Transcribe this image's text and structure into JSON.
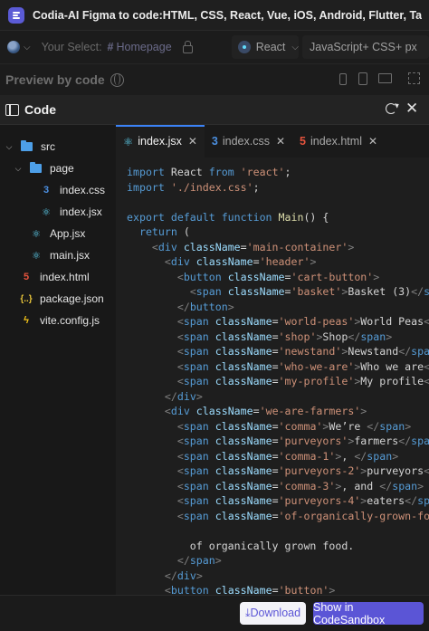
{
  "window": {
    "title": "Codia-AI Figma to code:HTML, CSS, React, Vue, iOS, Android, Flutter, Tailwind, W..."
  },
  "toolbar": {
    "your_select_label": "Your Select:",
    "hash": "#",
    "page_name": "Homepage",
    "framework": "React",
    "language": "JavaScript+ CSS+ px",
    "chevron": "⌵"
  },
  "preview": {
    "title": "Preview by code"
  },
  "code_panel": {
    "title": "Code",
    "close": "✕"
  },
  "file_tree": {
    "items": [
      {
        "label": "src",
        "chevron": "⌵"
      },
      {
        "label": "page",
        "chevron": "⌵"
      },
      {
        "label": "index.css",
        "icon": "3"
      },
      {
        "label": "index.jsx",
        "icon": "⚛"
      },
      {
        "label": "App.jsx",
        "icon": "⚛"
      },
      {
        "label": "main.jsx",
        "icon": "⚛"
      },
      {
        "label": "index.html",
        "icon": "5"
      },
      {
        "label": "package.json",
        "icon": "{..}"
      },
      {
        "label": "vite.config.js",
        "icon": "ϟ"
      }
    ]
  },
  "tabs": [
    {
      "label": "index.jsx",
      "icon": "⚛",
      "close": "✕"
    },
    {
      "label": "index.css",
      "icon": "3",
      "close": "✕"
    },
    {
      "label": "index.html",
      "icon": "5",
      "close": "✕"
    }
  ],
  "code": [
    [
      [
        "kw",
        "import "
      ],
      [
        "pl",
        "React "
      ],
      [
        "kw",
        "from "
      ],
      [
        "str",
        "'react'"
      ],
      [
        "pl",
        ";"
      ]
    ],
    [
      [
        "kw",
        "import "
      ],
      [
        "str",
        "'./index.css'"
      ],
      [
        "pl",
        ";"
      ]
    ],
    [],
    [
      [
        "kw",
        "export default function "
      ],
      [
        "fn",
        "Main"
      ],
      [
        "pl",
        "() {"
      ]
    ],
    [
      [
        "pl",
        "  "
      ],
      [
        "kw",
        "return"
      ],
      [
        "pl",
        " ("
      ]
    ],
    [
      [
        "pl",
        "    "
      ],
      [
        "br",
        "<"
      ],
      [
        "tg",
        "div "
      ],
      [
        "at",
        "className"
      ],
      [
        "pl",
        "="
      ],
      [
        "str",
        "'main-container'"
      ],
      [
        "br",
        ">"
      ]
    ],
    [
      [
        "pl",
        "      "
      ],
      [
        "br",
        "<"
      ],
      [
        "tg",
        "div "
      ],
      [
        "at",
        "className"
      ],
      [
        "pl",
        "="
      ],
      [
        "str",
        "'header'"
      ],
      [
        "br",
        ">"
      ]
    ],
    [
      [
        "pl",
        "        "
      ],
      [
        "br",
        "<"
      ],
      [
        "tg",
        "button "
      ],
      [
        "at",
        "className"
      ],
      [
        "pl",
        "="
      ],
      [
        "str",
        "'cart-button'"
      ],
      [
        "br",
        ">"
      ]
    ],
    [
      [
        "pl",
        "          "
      ],
      [
        "br",
        "<"
      ],
      [
        "tg",
        "span "
      ],
      [
        "at",
        "className"
      ],
      [
        "pl",
        "="
      ],
      [
        "str",
        "'basket'"
      ],
      [
        "br",
        ">"
      ],
      [
        "pl",
        "Basket (3)"
      ],
      [
        "br",
        "</"
      ],
      [
        "tg",
        "span"
      ],
      [
        "br",
        ">"
      ]
    ],
    [
      [
        "pl",
        "        "
      ],
      [
        "br",
        "</"
      ],
      [
        "tg",
        "button"
      ],
      [
        "br",
        ">"
      ]
    ],
    [
      [
        "pl",
        "        "
      ],
      [
        "br",
        "<"
      ],
      [
        "tg",
        "span "
      ],
      [
        "at",
        "className"
      ],
      [
        "pl",
        "="
      ],
      [
        "str",
        "'world-peas'"
      ],
      [
        "br",
        ">"
      ],
      [
        "pl",
        "World Peas"
      ],
      [
        "br",
        "</"
      ],
      [
        "tg",
        "span"
      ],
      [
        "br",
        ">"
      ]
    ],
    [
      [
        "pl",
        "        "
      ],
      [
        "br",
        "<"
      ],
      [
        "tg",
        "span "
      ],
      [
        "at",
        "className"
      ],
      [
        "pl",
        "="
      ],
      [
        "str",
        "'shop'"
      ],
      [
        "br",
        ">"
      ],
      [
        "pl",
        "Shop"
      ],
      [
        "br",
        "</"
      ],
      [
        "tg",
        "span"
      ],
      [
        "br",
        ">"
      ]
    ],
    [
      [
        "pl",
        "        "
      ],
      [
        "br",
        "<"
      ],
      [
        "tg",
        "span "
      ],
      [
        "at",
        "className"
      ],
      [
        "pl",
        "="
      ],
      [
        "str",
        "'newstand'"
      ],
      [
        "br",
        ">"
      ],
      [
        "pl",
        "Newstand"
      ],
      [
        "br",
        "</"
      ],
      [
        "tg",
        "span"
      ],
      [
        "br",
        ">"
      ]
    ],
    [
      [
        "pl",
        "        "
      ],
      [
        "br",
        "<"
      ],
      [
        "tg",
        "span "
      ],
      [
        "at",
        "className"
      ],
      [
        "pl",
        "="
      ],
      [
        "str",
        "'who-we-are'"
      ],
      [
        "br",
        ">"
      ],
      [
        "pl",
        "Who we are"
      ],
      [
        "br",
        "</"
      ],
      [
        "tg",
        "span"
      ],
      [
        "br",
        ">"
      ]
    ],
    [
      [
        "pl",
        "        "
      ],
      [
        "br",
        "<"
      ],
      [
        "tg",
        "span "
      ],
      [
        "at",
        "className"
      ],
      [
        "pl",
        "="
      ],
      [
        "str",
        "'my-profile'"
      ],
      [
        "br",
        ">"
      ],
      [
        "pl",
        "My profile"
      ],
      [
        "br",
        "</"
      ],
      [
        "tg",
        "span"
      ],
      [
        "br",
        ">"
      ]
    ],
    [
      [
        "pl",
        "      "
      ],
      [
        "br",
        "</"
      ],
      [
        "tg",
        "div"
      ],
      [
        "br",
        ">"
      ]
    ],
    [
      [
        "pl",
        "      "
      ],
      [
        "br",
        "<"
      ],
      [
        "tg",
        "div "
      ],
      [
        "at",
        "className"
      ],
      [
        "pl",
        "="
      ],
      [
        "str",
        "'we-are-farmers'"
      ],
      [
        "br",
        ">"
      ]
    ],
    [
      [
        "pl",
        "        "
      ],
      [
        "br",
        "<"
      ],
      [
        "tg",
        "span "
      ],
      [
        "at",
        "className"
      ],
      [
        "pl",
        "="
      ],
      [
        "str",
        "'comma'"
      ],
      [
        "br",
        ">"
      ],
      [
        "pl",
        "We’re "
      ],
      [
        "br",
        "</"
      ],
      [
        "tg",
        "span"
      ],
      [
        "br",
        ">"
      ]
    ],
    [
      [
        "pl",
        "        "
      ],
      [
        "br",
        "<"
      ],
      [
        "tg",
        "span "
      ],
      [
        "at",
        "className"
      ],
      [
        "pl",
        "="
      ],
      [
        "str",
        "'purveyors'"
      ],
      [
        "br",
        ">"
      ],
      [
        "pl",
        "farmers"
      ],
      [
        "br",
        "</"
      ],
      [
        "tg",
        "span"
      ],
      [
        "br",
        ">"
      ]
    ],
    [
      [
        "pl",
        "        "
      ],
      [
        "br",
        "<"
      ],
      [
        "tg",
        "span "
      ],
      [
        "at",
        "className"
      ],
      [
        "pl",
        "="
      ],
      [
        "str",
        "'comma-1'"
      ],
      [
        "br",
        ">"
      ],
      [
        "pl",
        ", "
      ],
      [
        "br",
        "</"
      ],
      [
        "tg",
        "span"
      ],
      [
        "br",
        ">"
      ]
    ],
    [
      [
        "pl",
        "        "
      ],
      [
        "br",
        "<"
      ],
      [
        "tg",
        "span "
      ],
      [
        "at",
        "className"
      ],
      [
        "pl",
        "="
      ],
      [
        "str",
        "'purveyors-2'"
      ],
      [
        "br",
        ">"
      ],
      [
        "pl",
        "purveyors"
      ],
      [
        "br",
        "</"
      ],
      [
        "tg",
        "span"
      ],
      [
        "br",
        ">"
      ]
    ],
    [
      [
        "pl",
        "        "
      ],
      [
        "br",
        "<"
      ],
      [
        "tg",
        "span "
      ],
      [
        "at",
        "className"
      ],
      [
        "pl",
        "="
      ],
      [
        "str",
        "'comma-3'"
      ],
      [
        "br",
        ">"
      ],
      [
        "pl",
        ", and "
      ],
      [
        "br",
        "</"
      ],
      [
        "tg",
        "span"
      ],
      [
        "br",
        ">"
      ]
    ],
    [
      [
        "pl",
        "        "
      ],
      [
        "br",
        "<"
      ],
      [
        "tg",
        "span "
      ],
      [
        "at",
        "className"
      ],
      [
        "pl",
        "="
      ],
      [
        "str",
        "'purveyors-4'"
      ],
      [
        "br",
        ">"
      ],
      [
        "pl",
        "eaters"
      ],
      [
        "br",
        "</"
      ],
      [
        "tg",
        "span"
      ],
      [
        "br",
        ">"
      ]
    ],
    [
      [
        "pl",
        "        "
      ],
      [
        "br",
        "<"
      ],
      [
        "tg",
        "span "
      ],
      [
        "at",
        "className"
      ],
      [
        "pl",
        "="
      ],
      [
        "str",
        "'of-organically-grown-food'"
      ],
      [
        "br",
        ">"
      ]
    ],
    [],
    [
      [
        "pl",
        "          of organically grown food."
      ]
    ],
    [
      [
        "pl",
        "        "
      ],
      [
        "br",
        "</"
      ],
      [
        "tg",
        "span"
      ],
      [
        "br",
        ">"
      ]
    ],
    [
      [
        "pl",
        "      "
      ],
      [
        "br",
        "</"
      ],
      [
        "tg",
        "div"
      ],
      [
        "br",
        ">"
      ]
    ],
    [
      [
        "pl",
        "      "
      ],
      [
        "br",
        "<"
      ],
      [
        "tg",
        "button "
      ],
      [
        "at",
        "className"
      ],
      [
        "pl",
        "="
      ],
      [
        "str",
        "'button'"
      ],
      [
        "br",
        ">"
      ]
    ]
  ],
  "actions": {
    "download": "⤓Download",
    "sandbox": "Show in CodeSandbox"
  }
}
